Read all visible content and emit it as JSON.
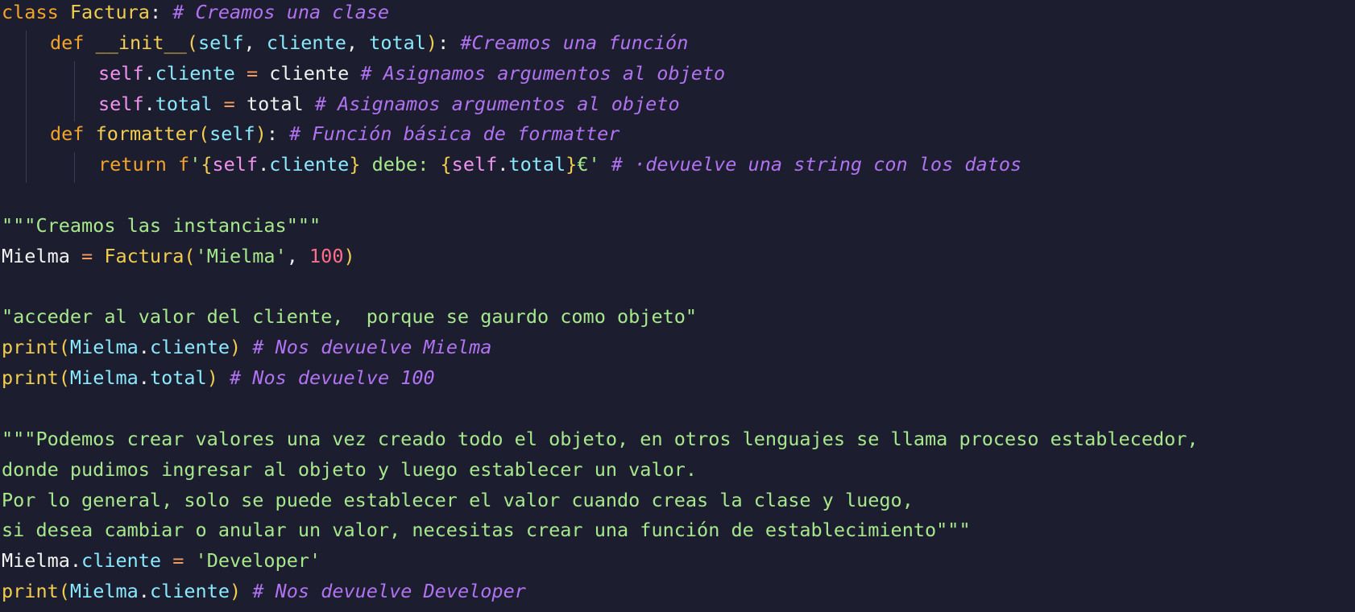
{
  "editor": {
    "colors": {
      "background": "#1c1d2e",
      "keyword": "#f4a32b",
      "class_name": "#f2cd4f",
      "self": "#ee93ee",
      "attribute": "#8be9fd",
      "operator": "#f39c5d",
      "string": "#a6e88b",
      "number": "#ff6e8a",
      "comment": "#b173f2",
      "text": "#f1f1f0"
    },
    "lines": [
      {
        "indent": 0,
        "tokens": [
          {
            "t": "class ",
            "k": "kw"
          },
          {
            "t": "Factura",
            "k": "cls"
          },
          {
            "t": ": ",
            "k": "punc"
          },
          {
            "t": "# Creamos una clase",
            "k": "com"
          }
        ]
      },
      {
        "indent": 1,
        "tokens": [
          {
            "t": "def ",
            "k": "kw"
          },
          {
            "t": "__init__",
            "k": "fn"
          },
          {
            "t": "(",
            "k": "brk"
          },
          {
            "t": "self",
            "k": "attr"
          },
          {
            "t": ", ",
            "k": "punc"
          },
          {
            "t": "cliente",
            "k": "attr"
          },
          {
            "t": ", ",
            "k": "punc"
          },
          {
            "t": "total",
            "k": "attr"
          },
          {
            "t": ")",
            "k": "brk"
          },
          {
            "t": ": ",
            "k": "punc"
          },
          {
            "t": "#Creamos una función",
            "k": "com"
          }
        ]
      },
      {
        "indent": 2,
        "tokens": [
          {
            "t": "self",
            "k": "self"
          },
          {
            "t": ".",
            "k": "punc"
          },
          {
            "t": "cliente",
            "k": "attr"
          },
          {
            "t": " = ",
            "k": "op"
          },
          {
            "t": "cliente",
            "k": "var"
          },
          {
            "t": " ",
            "k": "punc"
          },
          {
            "t": "# Asignamos argumentos al objeto",
            "k": "com"
          }
        ]
      },
      {
        "indent": 2,
        "tokens": [
          {
            "t": "self",
            "k": "self"
          },
          {
            "t": ".",
            "k": "punc"
          },
          {
            "t": "total",
            "k": "attr"
          },
          {
            "t": " = ",
            "k": "op"
          },
          {
            "t": "total",
            "k": "var"
          },
          {
            "t": " ",
            "k": "punc"
          },
          {
            "t": "# Asignamos argumentos al objeto",
            "k": "com"
          }
        ]
      },
      {
        "indent": 1,
        "tokens": [
          {
            "t": "def ",
            "k": "kw"
          },
          {
            "t": "formatter",
            "k": "fn"
          },
          {
            "t": "(",
            "k": "brk"
          },
          {
            "t": "self",
            "k": "attr"
          },
          {
            "t": ")",
            "k": "brk"
          },
          {
            "t": ": ",
            "k": "punc"
          },
          {
            "t": "# Función básica de formatter",
            "k": "com"
          }
        ]
      },
      {
        "indent": 2,
        "tokens": [
          {
            "t": "return ",
            "k": "kw"
          },
          {
            "t": "f",
            "k": "kw"
          },
          {
            "t": "'",
            "k": "str"
          },
          {
            "t": "{",
            "k": "brk"
          },
          {
            "t": "self",
            "k": "self"
          },
          {
            "t": ".",
            "k": "punc"
          },
          {
            "t": "cliente",
            "k": "attr"
          },
          {
            "t": "}",
            "k": "brk"
          },
          {
            "t": " debe: ",
            "k": "str"
          },
          {
            "t": "{",
            "k": "brk"
          },
          {
            "t": "self",
            "k": "self"
          },
          {
            "t": ".",
            "k": "punc"
          },
          {
            "t": "total",
            "k": "attr"
          },
          {
            "t": "}",
            "k": "brk"
          },
          {
            "t": "€'",
            "k": "str"
          },
          {
            "t": " ",
            "k": "punc"
          },
          {
            "t": "# ·devuelve una string con los datos",
            "k": "com"
          }
        ]
      },
      {
        "indent": 0,
        "tokens": []
      },
      {
        "indent": 0,
        "tokens": [
          {
            "t": "\"\"\"Creamos las instancias\"\"\"",
            "k": "str"
          }
        ]
      },
      {
        "indent": 0,
        "tokens": [
          {
            "t": "Mielma",
            "k": "var"
          },
          {
            "t": " = ",
            "k": "op"
          },
          {
            "t": "Factura",
            "k": "cls"
          },
          {
            "t": "(",
            "k": "brk"
          },
          {
            "t": "'Mielma'",
            "k": "str"
          },
          {
            "t": ", ",
            "k": "punc"
          },
          {
            "t": "100",
            "k": "num"
          },
          {
            "t": ")",
            "k": "brk"
          }
        ]
      },
      {
        "indent": 0,
        "tokens": []
      },
      {
        "indent": 0,
        "tokens": [
          {
            "t": "\"acceder al valor del cliente,  porque se gaurdo como objeto\"",
            "k": "str"
          }
        ]
      },
      {
        "indent": 0,
        "tokens": [
          {
            "t": "print",
            "k": "fn"
          },
          {
            "t": "(",
            "k": "brk"
          },
          {
            "t": "Mielma",
            "k": "attr"
          },
          {
            "t": ".",
            "k": "punc"
          },
          {
            "t": "cliente",
            "k": "attr"
          },
          {
            "t": ")",
            "k": "brk"
          },
          {
            "t": " ",
            "k": "punc"
          },
          {
            "t": "# Nos devuelve Mielma",
            "k": "com"
          }
        ]
      },
      {
        "indent": 0,
        "tokens": [
          {
            "t": "print",
            "k": "fn"
          },
          {
            "t": "(",
            "k": "brk"
          },
          {
            "t": "Mielma",
            "k": "attr"
          },
          {
            "t": ".",
            "k": "punc"
          },
          {
            "t": "total",
            "k": "attr"
          },
          {
            "t": ")",
            "k": "brk"
          },
          {
            "t": " ",
            "k": "punc"
          },
          {
            "t": "# Nos devuelve 100",
            "k": "com"
          }
        ]
      },
      {
        "indent": 0,
        "tokens": []
      },
      {
        "indent": 0,
        "tokens": [
          {
            "t": "\"\"\"Podemos crear valores una vez creado todo el objeto, en otros lenguajes se llama proceso establecedor,",
            "k": "str"
          }
        ]
      },
      {
        "indent": 0,
        "tokens": [
          {
            "t": "donde pudimos ingresar al objeto y luego establecer un valor.",
            "k": "str"
          }
        ]
      },
      {
        "indent": 0,
        "tokens": [
          {
            "t": "Por lo general, solo se puede establecer el valor cuando creas la clase y luego,",
            "k": "str"
          }
        ]
      },
      {
        "indent": 0,
        "tokens": [
          {
            "t": "si desea cambiar o anular un valor, necesitas crear una función de establecimiento\"\"\"",
            "k": "str"
          }
        ]
      },
      {
        "indent": 0,
        "tokens": [
          {
            "t": "Mielma",
            "k": "var"
          },
          {
            "t": ".",
            "k": "punc"
          },
          {
            "t": "cliente",
            "k": "attr"
          },
          {
            "t": " = ",
            "k": "op"
          },
          {
            "t": "'Developer'",
            "k": "str"
          }
        ]
      },
      {
        "indent": 0,
        "tokens": [
          {
            "t": "print",
            "k": "fn"
          },
          {
            "t": "(",
            "k": "brk"
          },
          {
            "t": "Mielma",
            "k": "attr"
          },
          {
            "t": ".",
            "k": "punc"
          },
          {
            "t": "cliente",
            "k": "attr"
          },
          {
            "t": ")",
            "k": "brk"
          },
          {
            "t": " ",
            "k": "punc"
          },
          {
            "t": "# Nos devuelve Developer",
            "k": "com"
          }
        ]
      }
    ]
  }
}
